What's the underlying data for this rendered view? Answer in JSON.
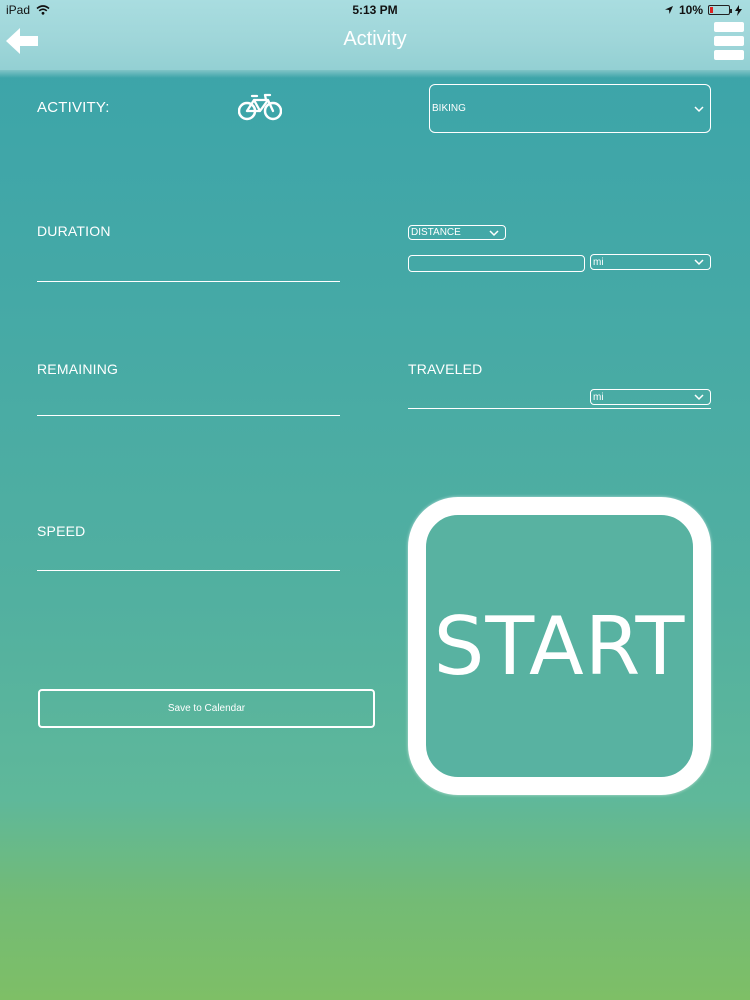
{
  "status_bar": {
    "device": "iPad",
    "time": "5:13 PM",
    "battery": "10%"
  },
  "nav": {
    "title": "Activity"
  },
  "activity": {
    "label": "ACTIVITY:",
    "icon": "bicycle-icon",
    "selected": "BIKING"
  },
  "duration": {
    "label": "DURATION"
  },
  "distance": {
    "mode_selected": "DISTANCE",
    "unit_selected": "mi"
  },
  "remaining": {
    "label": "REMAINING"
  },
  "traveled": {
    "label": "TRAVELED",
    "unit_selected": "mi"
  },
  "speed": {
    "label": "SPEED"
  },
  "save_button": {
    "label": "Save to Calendar"
  },
  "start_button": {
    "label": "START"
  },
  "colors": {
    "bg_top": "#3aa3aa",
    "bg_bottom": "#7ebf66",
    "navbar": "#9fd6d9",
    "foreground": "#ffffff"
  }
}
